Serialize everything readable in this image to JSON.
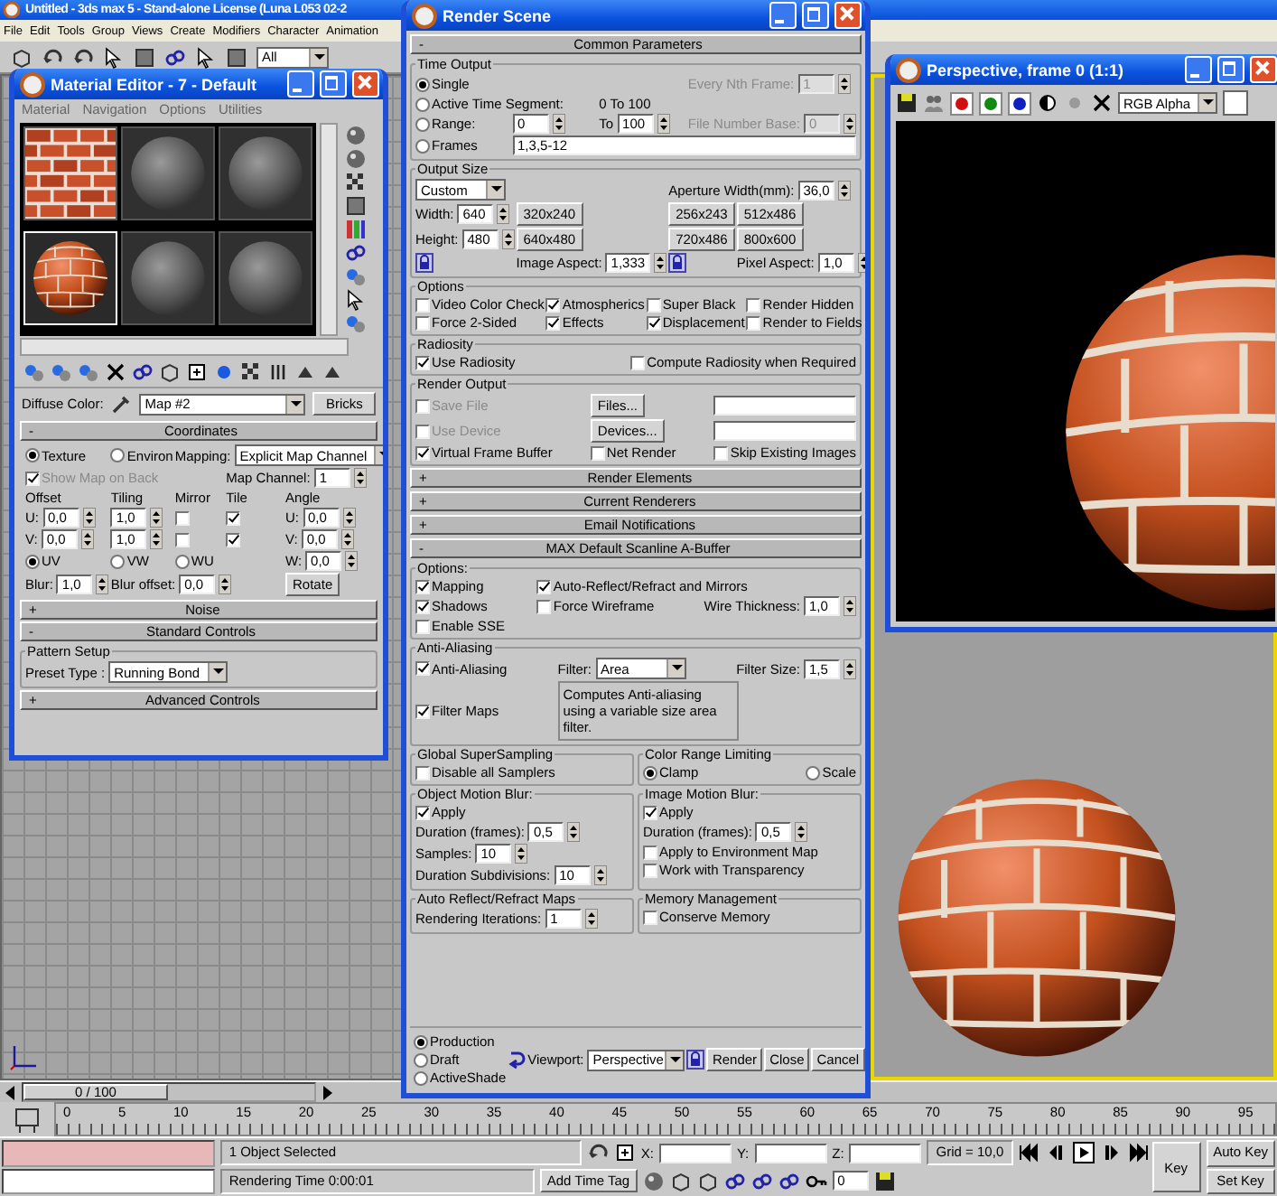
{
  "app": {
    "title": "Untitled - 3ds max 5 - Stand-alone License (Luna L053 02-2",
    "menu": [
      "File",
      "Edit",
      "Tools",
      "Group",
      "Views",
      "Create",
      "Modifiers",
      "Character",
      "Animation"
    ],
    "selection_filter": "All"
  },
  "material_editor": {
    "title": "Material Editor - 7 - Default",
    "menu": [
      "Material",
      "Navigation",
      "Options",
      "Utilities"
    ],
    "slots": [
      {
        "kind": "brick-tile",
        "selected": false
      },
      {
        "kind": "gray-sphere",
        "selected": false
      },
      {
        "kind": "gray-sphere",
        "selected": false
      },
      {
        "kind": "brick-sphere",
        "selected": true
      },
      {
        "kind": "gray-sphere",
        "selected": false
      },
      {
        "kind": "gray-sphere",
        "selected": false
      }
    ],
    "diffuse_label": "Diffuse Color:",
    "map_name": "Map #2",
    "map_type": "Bricks",
    "rollouts": [
      {
        "sign": "-",
        "title": "Coordinates",
        "groups": [
          {
            "kind": "plain",
            "rows": [
              [
                {
                  "kind": "radio",
                  "label": "Texture",
                  "selected": true
                },
                {
                  "kind": "radio",
                  "label": "Environ",
                  "selected": false
                },
                {
                  "kind": "dropdown",
                  "label": "Mapping:",
                  "value": "Explicit Map Channel"
                }
              ],
              [
                {
                  "kind": "check",
                  "label": "Show Map on Back",
                  "checked": true,
                  "disabled": true
                },
                "",
                "",
                {
                  "kind": "spinner",
                  "label": "Map Channel:",
                  "value": "1"
                }
              ],
              [
                {
                  "kind": "text",
                  "text": "Offset"
                },
                {
                  "kind": "text",
                  "text": "Tiling"
                },
                {
                  "kind": "text",
                  "text": "Mirror"
                },
                {
                  "kind": "text",
                  "text": "Tile"
                },
                {
                  "kind": "text",
                  "text": "Angle"
                }
              ],
              [
                {
                  "kind": "spinner",
                  "label": "U:",
                  "value": "0,0"
                },
                {
                  "kind": "spinner",
                  "value": "1,0"
                },
                {
                  "kind": "check",
                  "checked": false
                },
                {
                  "kind": "check",
                  "checked": true
                },
                {
                  "kind": "spinner",
                  "label": "U:",
                  "value": "0,0"
                }
              ],
              [
                {
                  "kind": "spinner",
                  "label": "V:",
                  "value": "0,0"
                },
                {
                  "kind": "spinner",
                  "value": "1,0"
                },
                {
                  "kind": "check",
                  "checked": false
                },
                {
                  "kind": "check",
                  "checked": true
                },
                {
                  "kind": "spinner",
                  "label": "V:",
                  "value": "0,0"
                }
              ],
              [
                {
                  "kind": "radio",
                  "label": "UV",
                  "selected": true
                },
                {
                  "kind": "radio",
                  "label": "VW",
                  "selected": false
                },
                {
                  "kind": "radio",
                  "label": "WU",
                  "selected": false
                },
                "",
                {
                  "kind": "spinner",
                  "label": "W:",
                  "value": "0,0"
                }
              ],
              [
                {
                  "kind": "spinner",
                  "label": "Blur:",
                  "value": "1,0"
                },
                {
                  "kind": "spinner",
                  "label": "Blur offset:",
                  "value": "0,0"
                },
                "",
                "",
                {
                  "kind": "button",
                  "label": "Rotate"
                }
              ]
            ]
          }
        ]
      },
      {
        "sign": "+",
        "title": "Noise"
      },
      {
        "sign": "-",
        "title": "Standard Controls",
        "groups": [
          {
            "kind": "full",
            "title": "Pattern Setup",
            "rows": [
              [
                {
                  "kind": "dropdown",
                  "label": "Preset Type :",
                  "value": "Running Bond"
                }
              ]
            ]
          }
        ]
      },
      {
        "sign": "+",
        "title": "Advanced Controls"
      }
    ]
  },
  "render_scene": {
    "title": "Render Scene",
    "rollouts": [
      {
        "sign": "-",
        "title": "Common Parameters",
        "groups": [
          {
            "kind": "full",
            "title": "Time Output",
            "rows": [
              [
                {
                  "kind": "radio",
                  "label": "Single",
                  "selected": true
                },
                "",
                "",
                {
                  "kind": "spinner",
                  "label": "Every Nth Frame:",
                  "value": "1",
                  "disabled": true
                }
              ],
              [
                {
                  "kind": "radio",
                  "label": "Active Time Segment:",
                  "selected": false
                },
                "",
                {
                  "kind": "text",
                  "text": "0 To 100"
                }
              ],
              [
                {
                  "kind": "radio",
                  "label": "Range:",
                  "selected": false
                },
                {
                  "kind": "spinner",
                  "value": "0"
                },
                {
                  "kind": "spinner",
                  "label": "To",
                  "value": "100"
                },
                {
                  "kind": "spinner",
                  "label": "File Number Base:",
                  "value": "0",
                  "disabled": true
                }
              ],
              [
                {
                  "kind": "radio",
                  "label": "Frames",
                  "selected": false
                },
                {
                  "kind": "field",
                  "value": "1,3,5-12"
                }
              ]
            ]
          },
          {
            "kind": "full",
            "title": "Output Size",
            "rows": [
              [
                {
                  "kind": "dropdown",
                  "value": "Custom"
                },
                "",
                {
                  "kind": "spinner",
                  "label": "Aperture Width(mm):",
                  "value": "36,0"
                }
              ],
              [
                {
                  "kind": "spinner",
                  "label": "Width:",
                  "value": "640"
                },
                {
                  "kind": "button",
                  "label": "320x240"
                },
                {
                  "kind": "button",
                  "label": "256x243"
                },
                {
                  "kind": "button",
                  "label": "512x486"
                }
              ],
              [
                {
                  "kind": "spinner",
                  "label": "Height:",
                  "value": "480"
                },
                {
                  "kind": "button",
                  "label": "640x480"
                },
                {
                  "kind": "button",
                  "label": "720x486"
                },
                {
                  "kind": "button",
                  "label": "800x600"
                }
              ],
              [
                {
                  "kind": "lock"
                },
                {
                  "kind": "spinner",
                  "label": "Image Aspect:",
                  "value": "1,333"
                },
                {
                  "kind": "lock"
                },
                {
                  "kind": "spinner",
                  "label": "Pixel Aspect:",
                  "value": "1,0"
                }
              ]
            ]
          },
          {
            "kind": "full",
            "title": "Options",
            "rows": [
              [
                {
                  "kind": "check",
                  "label": "Video Color Check",
                  "checked": false
                },
                {
                  "kind": "check",
                  "label": "Atmospherics",
                  "checked": true
                },
                {
                  "kind": "check",
                  "label": "Super Black",
                  "checked": false
                },
                {
                  "kind": "check",
                  "label": "Render Hidden",
                  "checked": false
                }
              ],
              [
                {
                  "kind": "check",
                  "label": "Force 2-Sided",
                  "checked": false
                },
                {
                  "kind": "check",
                  "label": "Effects",
                  "checked": true
                },
                {
                  "kind": "check",
                  "label": "Displacement",
                  "checked": true
                },
                {
                  "kind": "check",
                  "label": "Render to Fields",
                  "checked": false
                }
              ]
            ]
          },
          {
            "kind": "full",
            "title": "Radiosity",
            "rows": [
              [
                {
                  "kind": "check",
                  "label": "Use Radiosity",
                  "checked": true
                },
                {
                  "kind": "check",
                  "label": "Compute Radiosity when Required",
                  "checked": false
                }
              ]
            ]
          },
          {
            "kind": "full",
            "title": "Render Output",
            "rows": [
              [
                {
                  "kind": "check",
                  "label": "Save File",
                  "checked": false,
                  "disabled": true
                },
                {
                  "kind": "button",
                  "label": "Files..."
                },
                {
                  "kind": "field"
                }
              ],
              [
                {
                  "kind": "check",
                  "label": "Use Device",
                  "checked": false,
                  "disabled": true
                },
                {
                  "kind": "button",
                  "label": "Devices..."
                },
                {
                  "kind": "field"
                }
              ],
              [
                {
                  "kind": "check",
                  "label": "Virtual Frame Buffer",
                  "checked": true
                },
                {
                  "kind": "check",
                  "label": "Net Render",
                  "checked": false
                },
                {
                  "kind": "check",
                  "label": "Skip Existing Images",
                  "checked": false
                }
              ]
            ]
          }
        ]
      },
      {
        "sign": "+",
        "title": "Render Elements"
      },
      {
        "sign": "+",
        "title": "Current Renderers"
      },
      {
        "sign": "+",
        "title": "Email Notifications"
      },
      {
        "sign": "-",
        "title": "MAX Default Scanline A-Buffer",
        "groups": [
          {
            "kind": "full",
            "title": "Options:",
            "rows": [
              [
                {
                  "kind": "check",
                  "label": "Mapping",
                  "checked": true
                },
                {
                  "kind": "check",
                  "label": "Auto-Reflect/Refract and Mirrors",
                  "checked": true
                }
              ],
              [
                {
                  "kind": "check",
                  "label": "Shadows",
                  "checked": true
                },
                {
                  "kind": "check",
                  "label": "Force Wireframe",
                  "checked": false
                },
                {
                  "kind": "spinner",
                  "label": "Wire Thickness:",
                  "value": "1,0"
                }
              ],
              [
                {
                  "kind": "check",
                  "label": "Enable SSE",
                  "checked": false
                }
              ]
            ]
          },
          {
            "kind": "full",
            "title": "Anti-Aliasing",
            "rows": [
              [
                {
                  "kind": "check",
                  "label": "Anti-Aliasing",
                  "checked": true
                },
                {
                  "kind": "dropdown",
                  "label": "Filter:",
                  "value": "Area"
                },
                {
                  "kind": "spinner",
                  "label": "Filter Size:",
                  "value": "1,5"
                }
              ],
              [
                {
                  "kind": "check",
                  "label": "Filter Maps",
                  "checked": true
                },
                {
                  "kind": "note",
                  "text": "Computes Anti-aliasing using a variable size area filter."
                }
              ]
            ]
          },
          {
            "kind": "half",
            "title": "Global SuperSampling",
            "rows": [
              [
                {
                  "kind": "check",
                  "label": "Disable all Samplers",
                  "checked": false
                }
              ]
            ]
          },
          {
            "kind": "half",
            "title": "Color Range Limiting",
            "rows": [
              [
                {
                  "kind": "radio",
                  "label": "Clamp",
                  "selected": true
                },
                {
                  "kind": "radio",
                  "label": "Scale",
                  "selected": false
                }
              ]
            ]
          },
          {
            "kind": "half",
            "title": "Object Motion Blur:",
            "rows": [
              [
                {
                  "kind": "check",
                  "label": "Apply",
                  "checked": true
                }
              ],
              [
                {
                  "kind": "spinner",
                  "label": "Duration (frames):",
                  "value": "0,5"
                }
              ],
              [
                {
                  "kind": "spinner",
                  "label": "Samples:",
                  "value": "10"
                }
              ],
              [
                {
                  "kind": "spinner",
                  "label": "Duration Subdivisions:",
                  "value": "10"
                }
              ]
            ]
          },
          {
            "kind": "half",
            "title": "Image Motion Blur:",
            "rows": [
              [
                {
                  "kind": "check",
                  "label": "Apply",
                  "checked": true
                }
              ],
              [
                {
                  "kind": "spinner",
                  "label": "Duration (frames):",
                  "value": "0,5"
                }
              ],
              [
                {
                  "kind": "check",
                  "label": "Apply to Environment Map",
                  "checked": false
                }
              ],
              [
                {
                  "kind": "check",
                  "label": "Work with Transparency",
                  "checked": false
                }
              ]
            ]
          },
          {
            "kind": "half",
            "title": "Auto Reflect/Refract Maps",
            "rows": [
              [
                {
                  "kind": "spinner",
                  "label": "Rendering Iterations:",
                  "value": "1"
                }
              ]
            ]
          },
          {
            "kind": "half",
            "title": "Memory Management",
            "rows": [
              [
                {
                  "kind": "check",
                  "label": "Conserve Memory",
                  "checked": false
                }
              ]
            ]
          }
        ]
      }
    ],
    "modes": [
      {
        "label": "Production",
        "selected": true
      },
      {
        "label": "Draft",
        "selected": false
      },
      {
        "label": "ActiveShade",
        "selected": false
      }
    ],
    "viewport_label": "Viewport:",
    "viewport": "Perspective",
    "buttons": [
      "Render",
      "Close",
      "Cancel"
    ]
  },
  "frame_window": {
    "title": "Perspective, frame 0 (1:1)",
    "channels": [
      {
        "color": "#d01010",
        "on": true
      },
      {
        "color": "#108a10",
        "on": true
      },
      {
        "color": "#1020c0",
        "on": true
      }
    ],
    "display": "RGB Alpha"
  },
  "time_slider": {
    "label": "0 / 100",
    "level": 0
  },
  "track_ticks": [
    "0",
    "5",
    "10",
    "15",
    "20",
    "25",
    "30",
    "35",
    "40",
    "45",
    "50",
    "55",
    "60",
    "65",
    "70",
    "75",
    "80",
    "85",
    "90",
    "95"
  ],
  "status": {
    "selection": "1 Object Selected",
    "render_time": "Rendering Time  0:00:01",
    "coords": [
      "X:",
      "Y:",
      "Z:"
    ],
    "grid": "Grid = 10,0",
    "add_time_tag": "Add Time Tag",
    "key": "Key",
    "auto_key": "Auto Key",
    "set_key": "Set Key",
    "frame": "0"
  }
}
